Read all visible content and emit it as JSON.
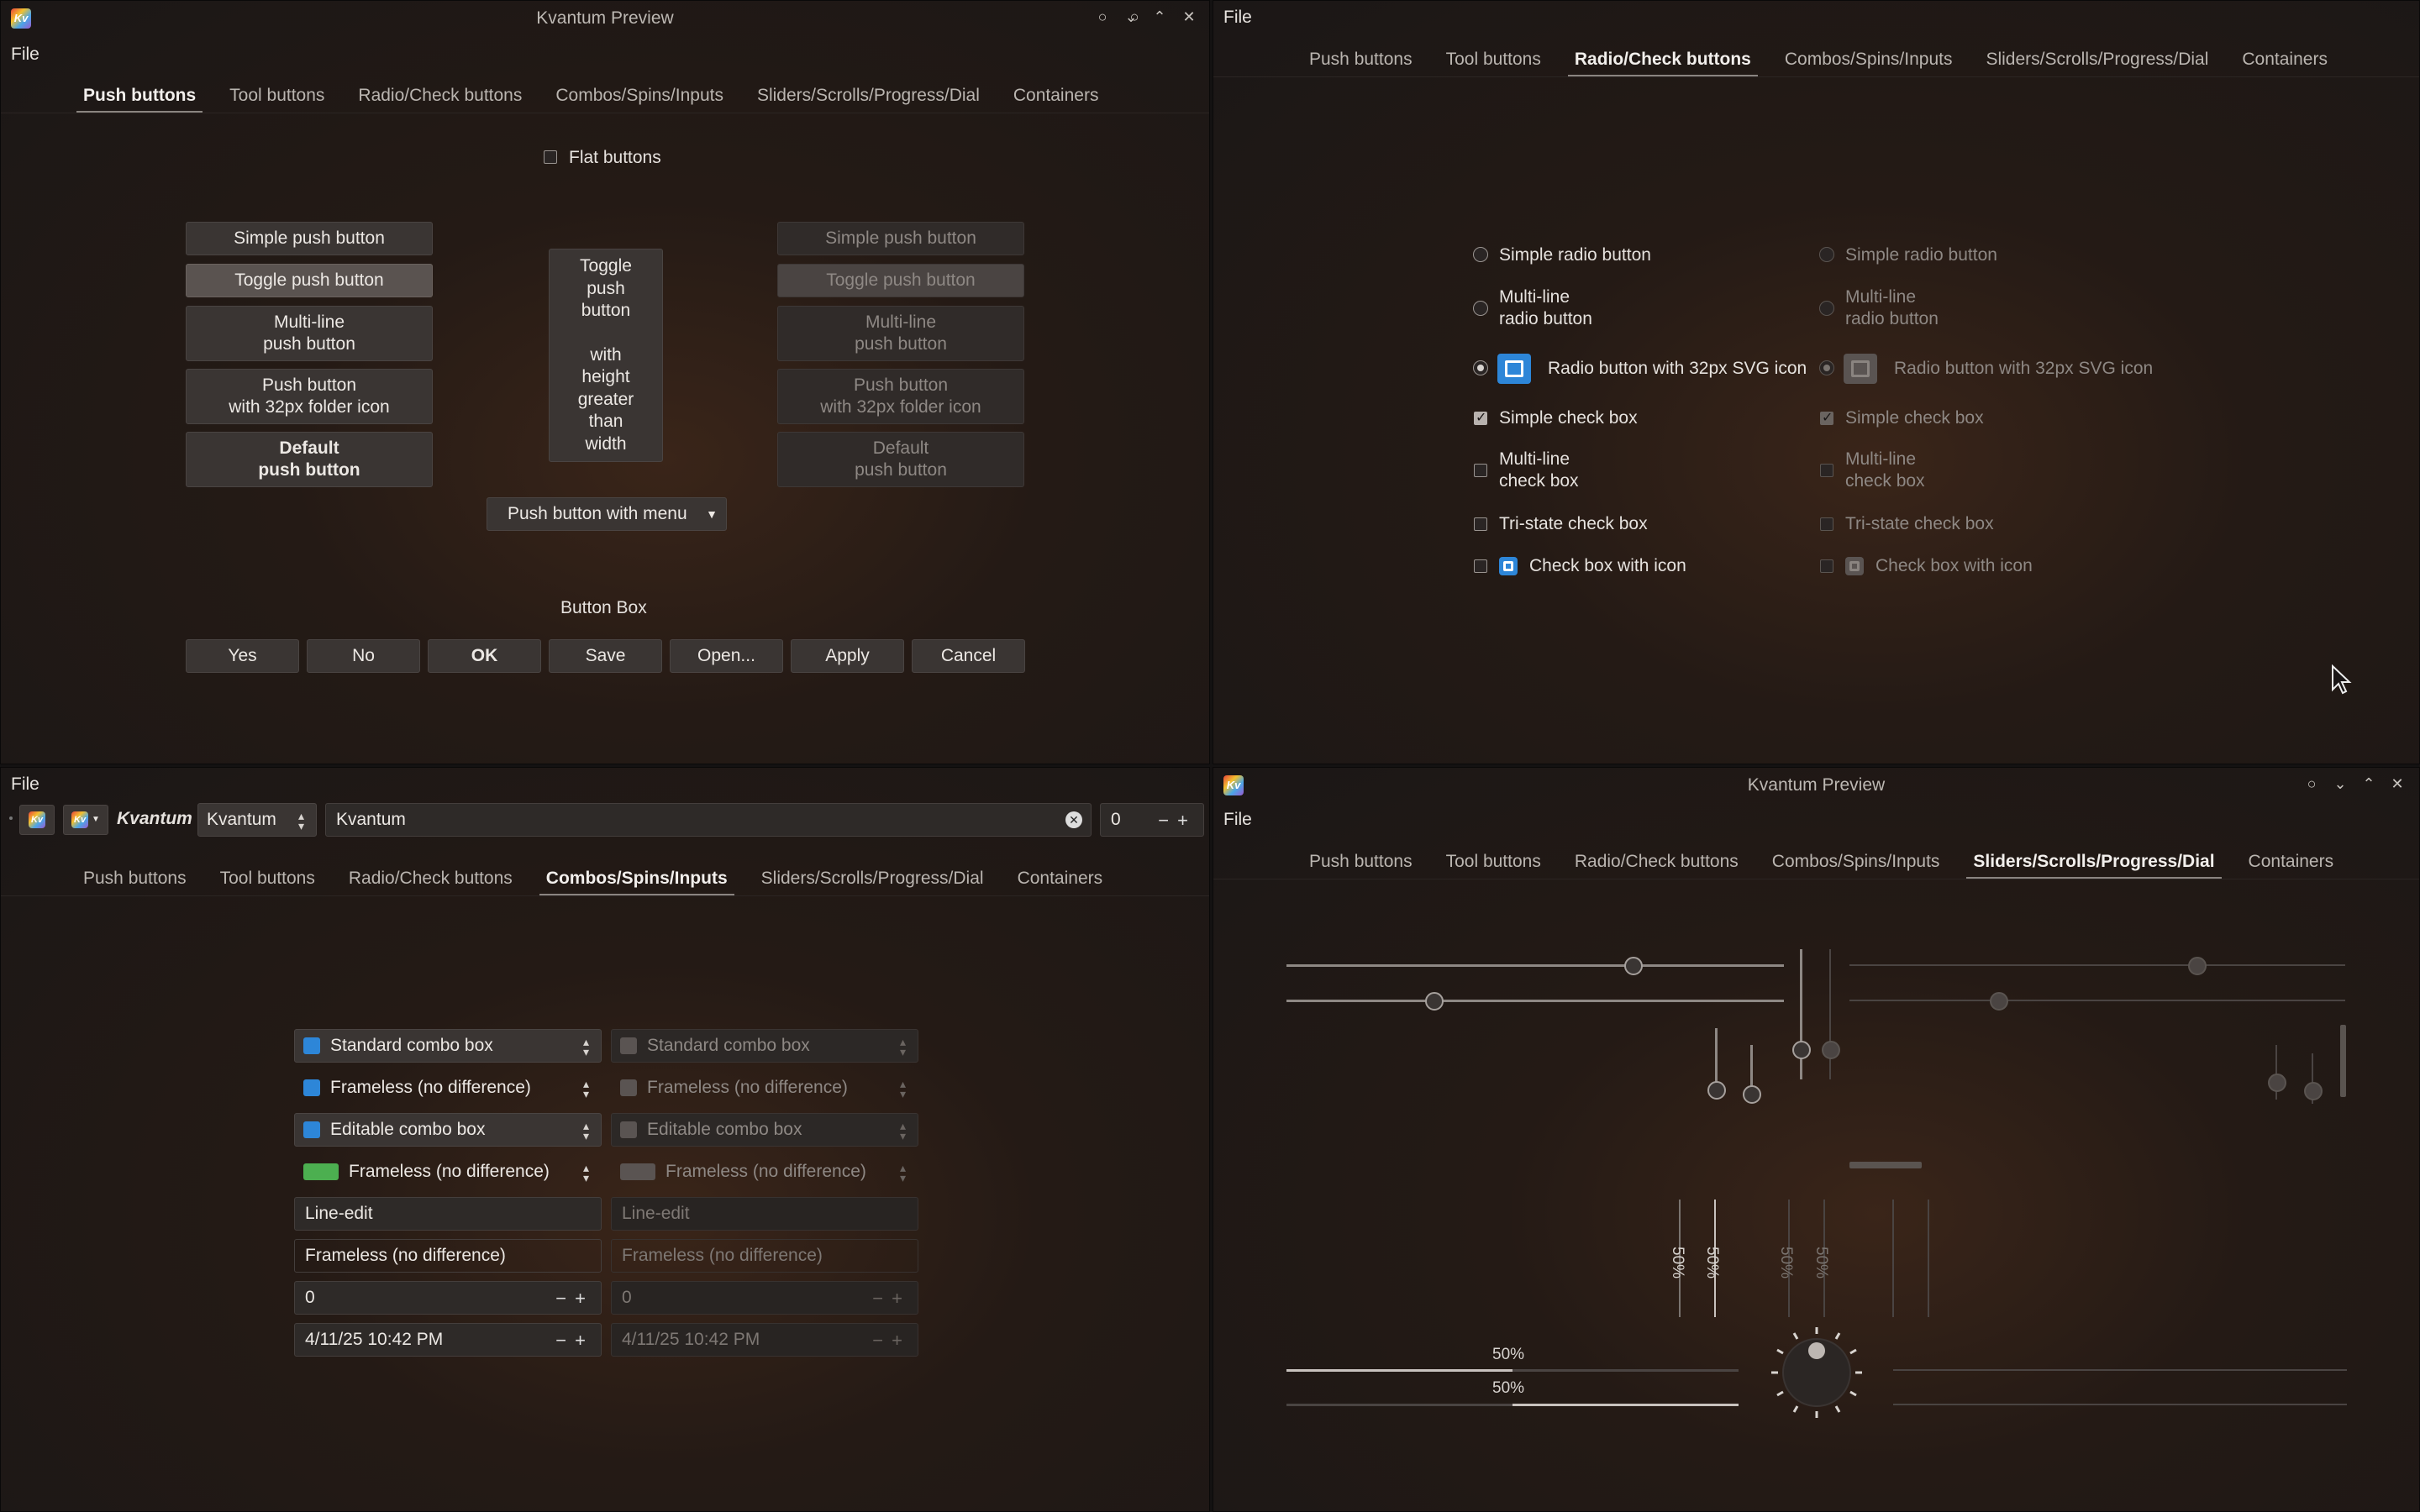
{
  "app_title": "Kvantum Preview",
  "menu_file": "File",
  "tabs": [
    "Push buttons",
    "Tool buttons",
    "Radio/Check buttons",
    "Combos/Spins/Inputs",
    "Sliders/Scrolls/Progress/Dial",
    "Containers"
  ],
  "push": {
    "flat_label": "Flat buttons",
    "simple": "Simple push button",
    "toggle": "Toggle push button",
    "multiline_1": "Multi-line",
    "multiline_2": "push button",
    "folder_1": "Push button",
    "folder_2": "with 32px folder icon",
    "default_1": "Default",
    "default_2": "push button",
    "tall_lines": [
      "Toggle",
      "push",
      "button",
      "",
      "with",
      "height",
      "greater",
      "than",
      "width"
    ],
    "menu_button": "Push button with menu",
    "button_box_label": "Button Box",
    "button_box": [
      "Yes",
      "No",
      "OK",
      "Save",
      "Open...",
      "Apply",
      "Cancel"
    ]
  },
  "radio": {
    "simple_radio": "Simple radio button",
    "multi_radio_1": "Multi-line",
    "multi_radio_2": "radio button",
    "svg_radio": "Radio button with 32px SVG icon",
    "simple_check": "Simple check box",
    "multi_check_1": "Multi-line",
    "multi_check_2": "check box",
    "tristate": "Tri-state check box",
    "icon_check": "Check box with icon"
  },
  "toolbar": {
    "brand": "Kvantum",
    "combo_value": "Kvantum",
    "line_value": "Kvantum",
    "spin_value": "0"
  },
  "combos": {
    "standard": "Standard combo box",
    "frameless": "Frameless (no difference)",
    "editable": "Editable combo box",
    "line_edit": "Line-edit",
    "frameless_line": "Frameless (no difference)",
    "spin_value": "0",
    "datetime": "4/11/25 10:42 PM"
  },
  "progress": {
    "percent": "50%",
    "value": 0.5
  },
  "colors": {
    "accent_icon": "#2d86d8",
    "green_icon": "#4caf50"
  }
}
